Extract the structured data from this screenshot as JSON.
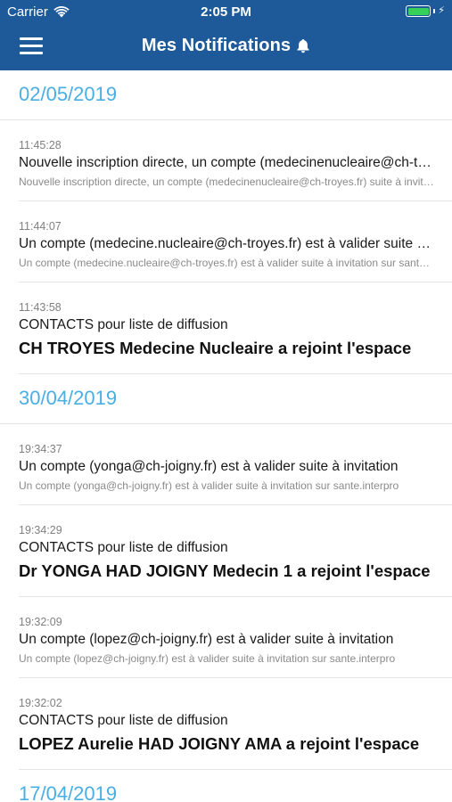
{
  "status_bar": {
    "carrier": "Carrier",
    "time": "2:05 PM",
    "battery_level": 1.0
  },
  "nav": {
    "title": "Mes Notifications",
    "menu_icon": "hamburger-menu-icon",
    "title_icon": "bell-icon"
  },
  "colors": {
    "nav_background": "#1e5a9a",
    "date_header": "#4aaee3",
    "battery": "#35d15b"
  },
  "groups": [
    {
      "date": "02/05/2019",
      "items": [
        {
          "time": "11:45:28",
          "title": "Nouvelle inscription directe, un compte (medecinenucleaire@ch-troyes.fr) suite à invitation",
          "subtitle": "Nouvelle inscription directe, un compte (medecinenucleaire@ch-troyes.fr) suite à invitation sur sante.interpro"
        },
        {
          "time": "11:44:07",
          "title": "Un compte (medecine.nucleaire@ch-troyes.fr) est à valider suite à invitation",
          "subtitle": "Un compte (medecine.nucleaire@ch-troyes.fr) est à valider suite à invitation sur sante.interpro"
        },
        {
          "time": "11:43:58",
          "category": "CONTACTS pour liste de diffusion",
          "headline": "CH TROYES Medecine Nucleaire a rejoint l'espace"
        }
      ]
    },
    {
      "date": "30/04/2019",
      "items": [
        {
          "time": "19:34:37",
          "title": "Un compte (yonga@ch-joigny.fr) est à valider suite à invitation",
          "subtitle": "Un compte (yonga@ch-joigny.fr) est à valider suite à invitation sur sante.interpro"
        },
        {
          "time": "19:34:29",
          "category": "CONTACTS pour liste de diffusion",
          "headline": "Dr YONGA HAD JOIGNY Medecin 1 a rejoint l'espace"
        },
        {
          "time": "19:32:09",
          "title": "Un compte (lopez@ch-joigny.fr) est à valider suite à invitation",
          "subtitle": "Un compte (lopez@ch-joigny.fr) est à valider suite à invitation sur sante.interpro"
        },
        {
          "time": "19:32:02",
          "category": "CONTACTS pour liste de diffusion",
          "headline": "LOPEZ Aurelie HAD JOIGNY AMA a rejoint l'espace"
        }
      ]
    },
    {
      "date": "17/04/2019",
      "items": []
    }
  ]
}
